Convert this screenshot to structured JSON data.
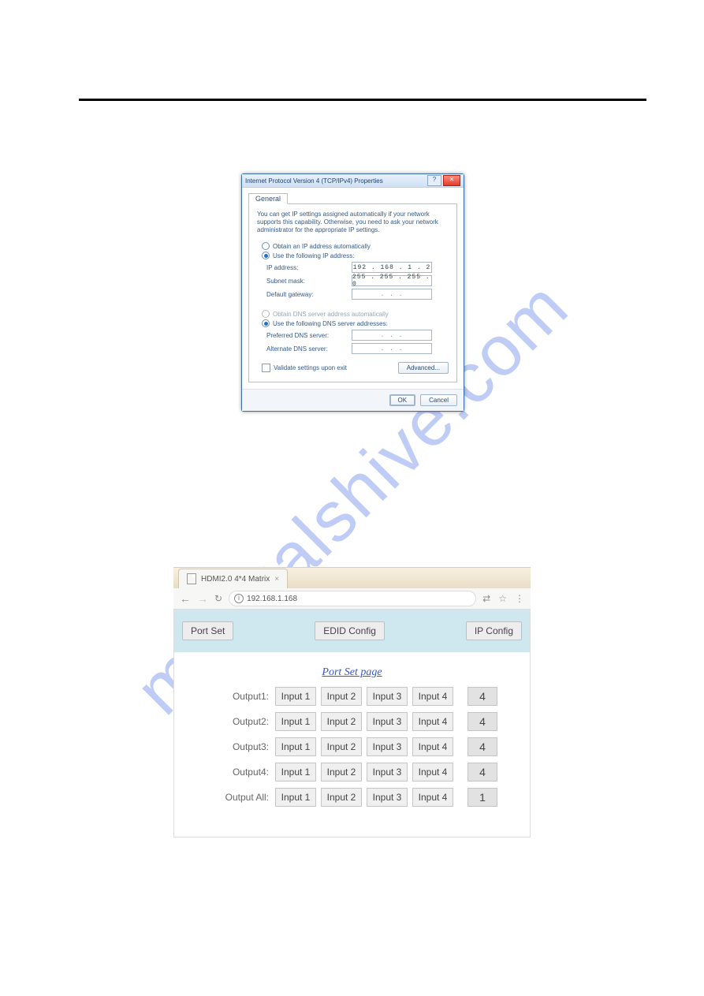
{
  "watermark_text": "manualshive.com",
  "dialog": {
    "title": "Internet Protocol Version 4 (TCP/IPv4) Properties",
    "help_glyph": "?",
    "close_glyph": "✕",
    "tab_label": "General",
    "description": "You can get IP settings assigned automatically if your network supports this capability. Otherwise, you need to ask your network administrator for the appropriate IP settings.",
    "radio_ip_auto": "Obtain an IP address automatically",
    "radio_ip_manual": "Use the following IP address:",
    "ip_fields": {
      "ip_label": "IP address:",
      "ip_value": "192 . 168 .  1  .  2",
      "subnet_label": "Subnet mask:",
      "subnet_value": "255 . 255 . 255 .  0",
      "gateway_label": "Default gateway:",
      "gateway_value": ".     .     ."
    },
    "radio_dns_auto": "Obtain DNS server address automatically",
    "radio_dns_manual": "Use the following DNS server addresses:",
    "dns_fields": {
      "preferred_label": "Preferred DNS server:",
      "preferred_value": ".     .     .",
      "alternate_label": "Alternate DNS server:",
      "alternate_value": ".     .     ."
    },
    "validate_label": "Validate settings upon exit",
    "advanced_btn": "Advanced...",
    "ok_btn": "OK",
    "cancel_btn": "Cancel"
  },
  "browser": {
    "tab_title": "HDMI2.0 4*4 Matrix",
    "tab_close_glyph": "×",
    "nav_back_glyph": "←",
    "nav_forward_glyph": "→",
    "reload_glyph": "↻",
    "info_glyph": "i",
    "url": "192.168.1.168",
    "translate_glyph": "⇄",
    "star_glyph": "☆",
    "menu_glyph": "⋮",
    "nav_buttons": {
      "port_set": "Port Set",
      "edid_config": "EDID Config",
      "ip_config": "IP Config"
    },
    "page_title": "Port Set page",
    "input_labels": [
      "Input 1",
      "Input 2",
      "Input 3",
      "Input 4"
    ],
    "rows": [
      {
        "label": "Output1:",
        "value": "4"
      },
      {
        "label": "Output2:",
        "value": "4"
      },
      {
        "label": "Output3:",
        "value": "4"
      },
      {
        "label": "Output4:",
        "value": "4"
      },
      {
        "label": "Output All:",
        "value": "1"
      }
    ]
  }
}
